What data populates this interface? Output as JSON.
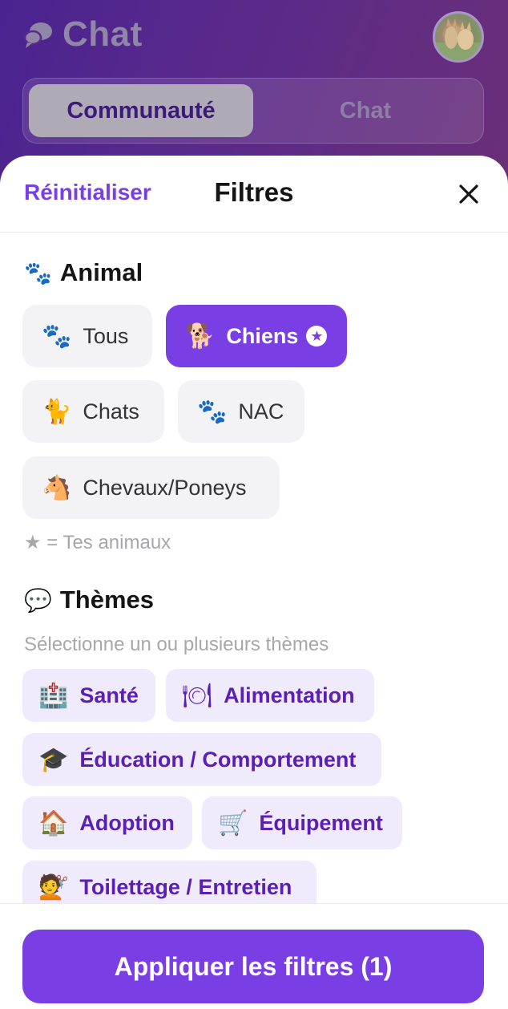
{
  "header": {
    "title": "Chat",
    "icon": "chat-bubble-icon",
    "segments": [
      {
        "label": "Communauté",
        "active": true
      },
      {
        "label": "Chat",
        "active": false
      }
    ]
  },
  "sheet": {
    "reset_label": "Réinitialiser",
    "title": "Filtres",
    "close_icon": "close-icon",
    "animal_section": {
      "emoji": "🐾",
      "title": "Animal",
      "options": [
        {
          "emoji": "🐾",
          "label": "Tous",
          "selected": false
        },
        {
          "emoji": "🐕",
          "label": "Chiens",
          "selected": true,
          "badge": "★"
        },
        {
          "emoji": "🐈",
          "label": "Chats",
          "selected": false
        },
        {
          "emoji": "🐾",
          "label": "NAC",
          "selected": false
        },
        {
          "emoji": "🐴",
          "label": "Chevaux/Poneys",
          "selected": false
        }
      ],
      "legend_star": "★",
      "legend_text": "= Tes animaux"
    },
    "themes_section": {
      "emoji": "💬",
      "title": "Thèmes",
      "subtitle": "Sélectionne un ou plusieurs thèmes",
      "options": [
        {
          "emoji": "🏥",
          "label": "Santé"
        },
        {
          "emoji": "🍽",
          "label": "Alimentation"
        },
        {
          "emoji": "🎓",
          "label": "Éducation / Comportement"
        },
        {
          "emoji": "🏠",
          "label": "Adoption"
        },
        {
          "emoji": "🛒",
          "label": "Équipement"
        },
        {
          "emoji": "💇",
          "label": "Toilettage / Entretien"
        }
      ]
    },
    "apply_label": "Appliquer les filtres (1)"
  },
  "colors": {
    "accent": "#7a3fe4",
    "theme_chip_bg": "#efeafc",
    "theme_chip_text": "#5b1fb3",
    "header_gradient_start": "#4a2390",
    "header_gradient_end": "#6a2f78"
  }
}
